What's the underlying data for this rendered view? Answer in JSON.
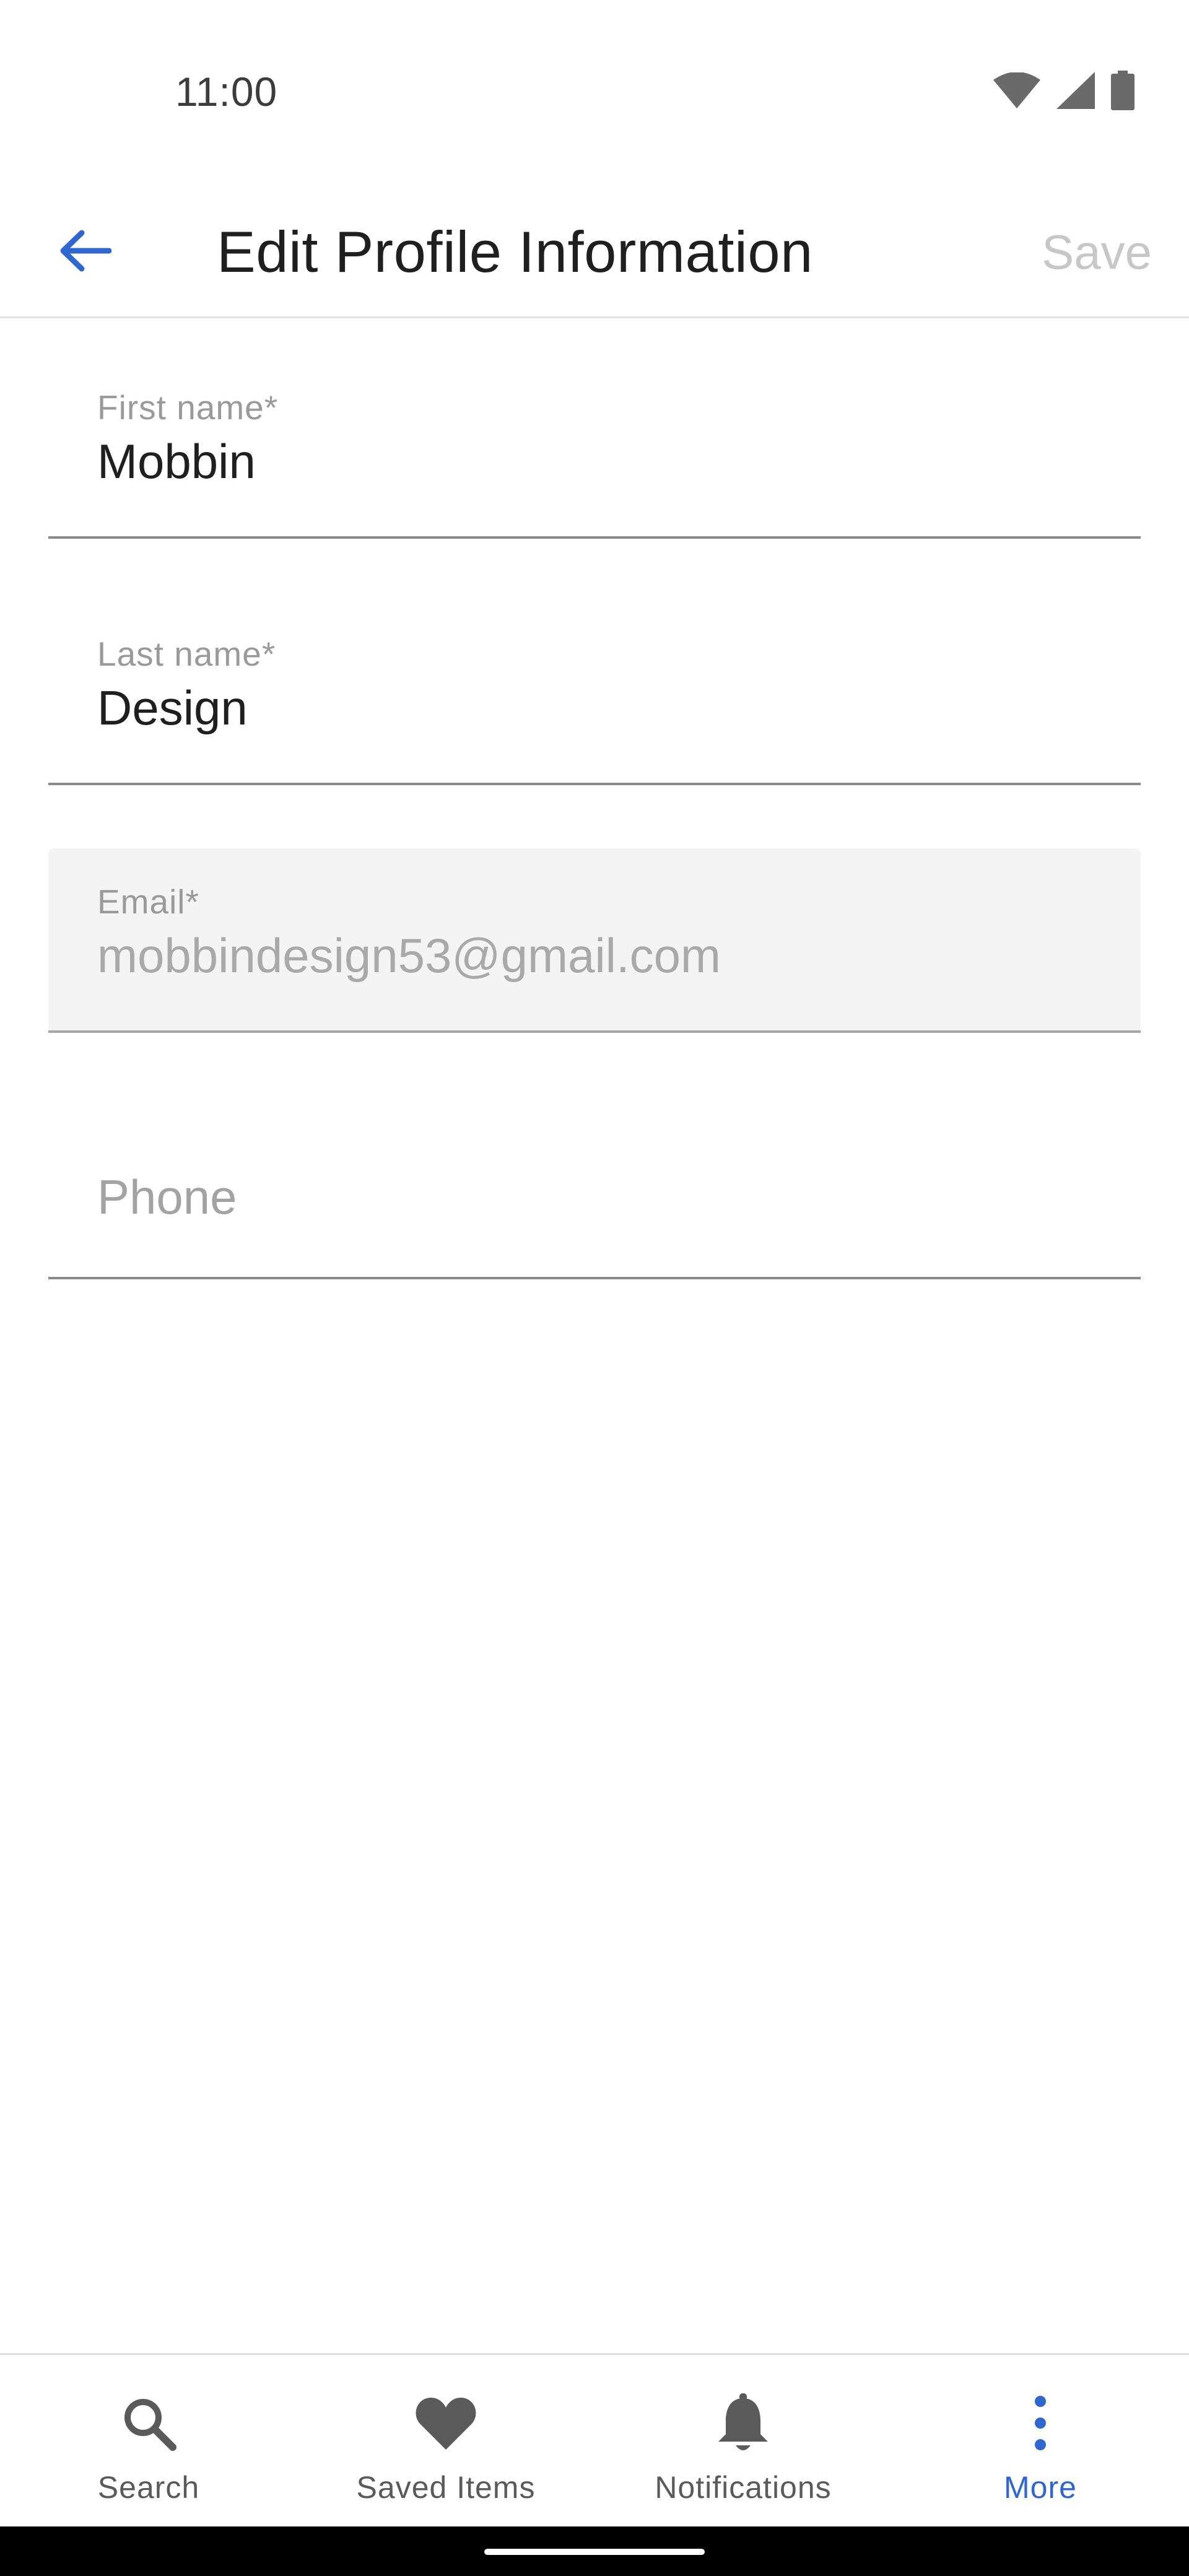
{
  "status_bar": {
    "time": "11:00",
    "icons": [
      "wifi-icon",
      "cellular-signal-icon",
      "battery-icon"
    ]
  },
  "app_bar": {
    "back_icon": "arrow-back-icon",
    "title": "Edit Profile Information",
    "save_label": "Save"
  },
  "form": {
    "first_name": {
      "label": "First name*",
      "value": "Mobbin"
    },
    "last_name": {
      "label": "Last name*",
      "value": "Design"
    },
    "email": {
      "label": "Email*",
      "value": "mobbindesign53@gmail.com",
      "disabled": true
    },
    "phone": {
      "placeholder": "Phone",
      "value": ""
    }
  },
  "bottom_nav": {
    "items": [
      {
        "label": "Search",
        "icon": "search-icon",
        "active": false
      },
      {
        "label": "Saved Items",
        "icon": "heart-icon",
        "active": false
      },
      {
        "label": "Notifications",
        "icon": "bell-icon",
        "active": false
      },
      {
        "label": "More",
        "icon": "more-vertical-icon",
        "active": true
      }
    ]
  },
  "colors": {
    "accent": "#2f66d0",
    "title_text": "#1f1f1f",
    "label_text": "#9a9a9a",
    "save_disabled": "#c7c7c7",
    "disabled_field_bg": "#f4f4f4"
  }
}
